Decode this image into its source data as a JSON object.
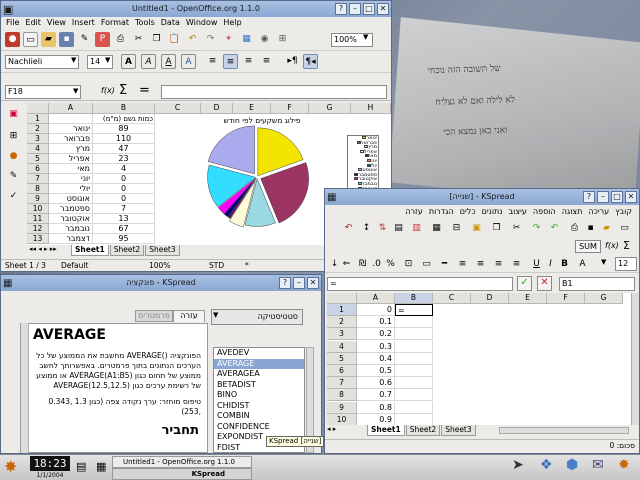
{
  "desktop": {
    "paper_text": [
      "של תשובה הזה נוכחי",
      "לא לילה ואם לא נצליח",
      "ואני כאן נמצא הכי"
    ]
  },
  "oo_window": {
    "title": "Untitled1 - OpenOffice.org 1.1.0",
    "menu": [
      "File",
      "Edit",
      "View",
      "Insert",
      "Format",
      "Tools",
      "Data",
      "Window",
      "Help"
    ],
    "zoom": "100%",
    "font_name": "Nachlieli",
    "font_size": "14",
    "name_box": "F18",
    "fx": "f(x)",
    "sigma": "Σ",
    "eq": "=",
    "columns": [
      "A",
      "B",
      "C",
      "D",
      "E",
      "F",
      "G",
      "H"
    ],
    "rows": [
      {
        "n": "1",
        "a": "",
        "b": "כמות גשם (מ\"מ)"
      },
      {
        "n": "2",
        "a": "ינואר",
        "b": "89"
      },
      {
        "n": "3",
        "a": "פברואר",
        "b": "110"
      },
      {
        "n": "4",
        "a": "מרץ",
        "b": "47"
      },
      {
        "n": "5",
        "a": "אפריל",
        "b": "23"
      },
      {
        "n": "6",
        "a": "מאי",
        "b": "4"
      },
      {
        "n": "7",
        "a": "יוני",
        "b": "0"
      },
      {
        "n": "8",
        "a": "יולי",
        "b": "0"
      },
      {
        "n": "9",
        "a": "אוגוסט",
        "b": "0"
      },
      {
        "n": "10",
        "a": "ספטמבר",
        "b": "7"
      },
      {
        "n": "11",
        "a": "אוקטובר",
        "b": "13"
      },
      {
        "n": "12",
        "a": "נובמבר",
        "b": "67"
      },
      {
        "n": "13",
        "a": "דצמבר",
        "b": "95"
      }
    ],
    "chart_title": "פילוג משקעים לפי חודש",
    "legend": [
      "ינואר",
      "פברואר",
      "מרץ",
      "אפריל",
      "מאי",
      "יוני",
      "יולי",
      "אוגוסט",
      "ספטמבר",
      "אוקטובר",
      "נובמבר",
      "דצמבר"
    ],
    "sheet_tabs": [
      "Sheet1",
      "Sheet2",
      "Sheet3"
    ],
    "status": {
      "sheet": "Sheet 1 / 3",
      "style": "Default",
      "zoom": "100%",
      "mode": "STD",
      "star": "*"
    }
  },
  "chart_data": {
    "type": "pie",
    "title": "פילוג משקעים לפי חודש",
    "categories": [
      "ינואר",
      "פברואר",
      "מרץ",
      "אפריל",
      "מאי",
      "יוני",
      "יולי",
      "אוגוסט",
      "ספטמבר",
      "אוקטובר",
      "נובמבר",
      "דצמבר"
    ],
    "values": [
      89,
      110,
      47,
      23,
      4,
      0,
      0,
      0,
      7,
      13,
      67,
      95
    ],
    "colors": [
      "#f2e600",
      "#9c3463",
      "#9ad8e2",
      "#fffbd6",
      "#5d0f5a",
      "#ff7f7f",
      "#0066cc",
      "#c8c8ff",
      "#000080",
      "#ff00ff",
      "#33ddff",
      "#aaaaee"
    ],
    "legend_position": "right"
  },
  "func_window": {
    "title": "פונקציה - KSpread",
    "tabs": [
      "עזרה",
      "פרמטרים"
    ],
    "doc_title": "AVERAGE",
    "doc_body": "הפונקציה ()AVERAGE מחשבת את הממוצע של כל הערכים הנתונים בתוך פרמטרים. באפשרותך לחשב ממוצע של תחום כגון AVERAGE(A1:B5) או ממוצע של רשימת ערכים כגון (AVERAGE(12.5,12.5",
    "return_type": "טיפוס מוחזר: ערך נקודה צפה (כגון 1.3 ,0.343 ,253)",
    "syntax": "תחביר",
    "category": "סטטיסטיקה",
    "functions": [
      "AVEDEV",
      "AVERAGE",
      "AVERAGEA",
      "BETADIST",
      "BINO",
      "CHIDIST",
      "COMBIN",
      "CONFIDENCE",
      "EXPONDIST",
      "FDIST"
    ],
    "selected": "AVERAGE"
  },
  "ks_window": {
    "title": "[שנייה] - KSpread",
    "menu": [
      "קובץ",
      "עריכה",
      "תצוגה",
      "הוספה",
      "עיצוב",
      "נתונים",
      "כלים",
      "הגדרות",
      "עזרה"
    ],
    "sum": "SUM",
    "fx": "f(x)",
    "sigma": "Σ",
    "font_size": "12",
    "bold": "B",
    "italic": "I",
    "underline": "U",
    "font_a": "A",
    "ref": "B1",
    "formula": "=",
    "columns": [
      "A",
      "B",
      "C",
      "D",
      "E",
      "F",
      "G"
    ],
    "rows": [
      {
        "n": "1",
        "a": "0",
        "b": "="
      },
      {
        "n": "2",
        "a": "0.1",
        "b": ""
      },
      {
        "n": "3",
        "a": "0.2",
        "b": ""
      },
      {
        "n": "4",
        "a": "0.3",
        "b": ""
      },
      {
        "n": "5",
        "a": "0.4",
        "b": ""
      },
      {
        "n": "6",
        "a": "0.5",
        "b": ""
      },
      {
        "n": "7",
        "a": "0.6",
        "b": ""
      },
      {
        "n": "8",
        "a": "0.7",
        "b": ""
      },
      {
        "n": "9",
        "a": "0.8",
        "b": ""
      },
      {
        "n": "10",
        "a": "0.9",
        "b": ""
      }
    ],
    "sheet_tabs": [
      "Sheet1",
      "Sheet2",
      "Sheet3"
    ],
    "status": "סכום: 0",
    "tooltip": "KSpread [שנייה]"
  },
  "taskbar": {
    "clock": "18:23",
    "date": "1/1/2004",
    "tasks": [
      "Untitled1 - OpenOffice.org 1.1.0",
      "KSpread"
    ]
  }
}
